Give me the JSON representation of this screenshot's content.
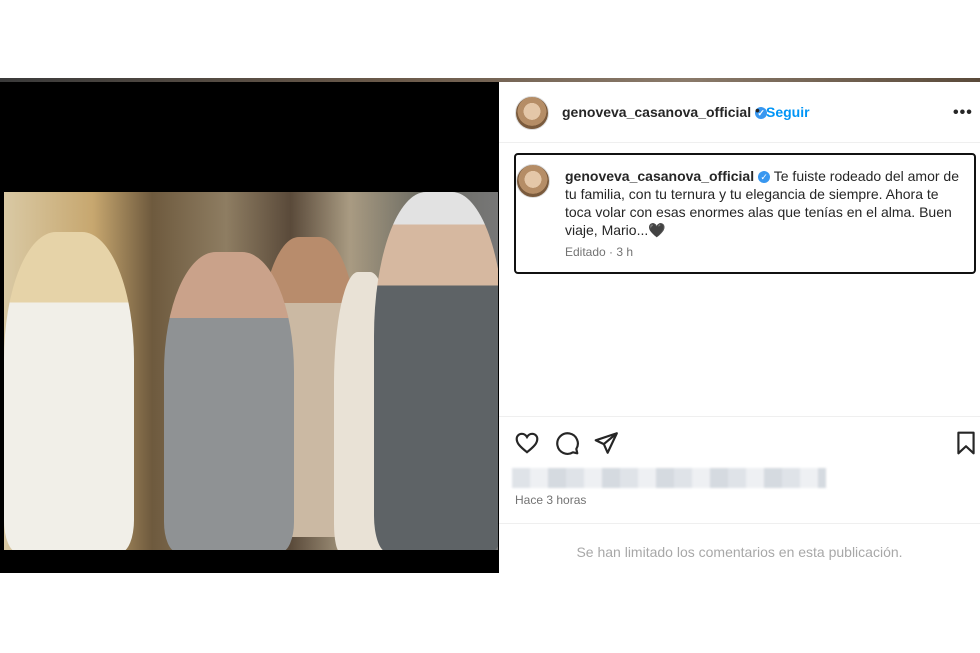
{
  "post": {
    "username": "genoveva_casanova_official",
    "verified_badge": "✓",
    "separator": "•",
    "follow_label": "Seguir",
    "more_label": "•••",
    "caption": "Te fuiste rodeado del amor de tu familia, con tu ternura y tu elegancia de siempre. Ahora te toca volar con esas enormes alas que tenías en el alma. Buen viaje, Mario...🖤",
    "edited_label": "Editado · 3 h",
    "timestamp": "Hace 3 horas",
    "comments_limited": "Se han limitado los comentarios en esta publicación."
  },
  "icons": [
    "heart-icon",
    "comment-icon",
    "share-icon",
    "bookmark-icon",
    "more-icon",
    "verified-icon"
  ],
  "colors": {
    "accent": "#0095f6",
    "verified": "#3897f0",
    "text": "#262626",
    "muted": "#737373"
  }
}
